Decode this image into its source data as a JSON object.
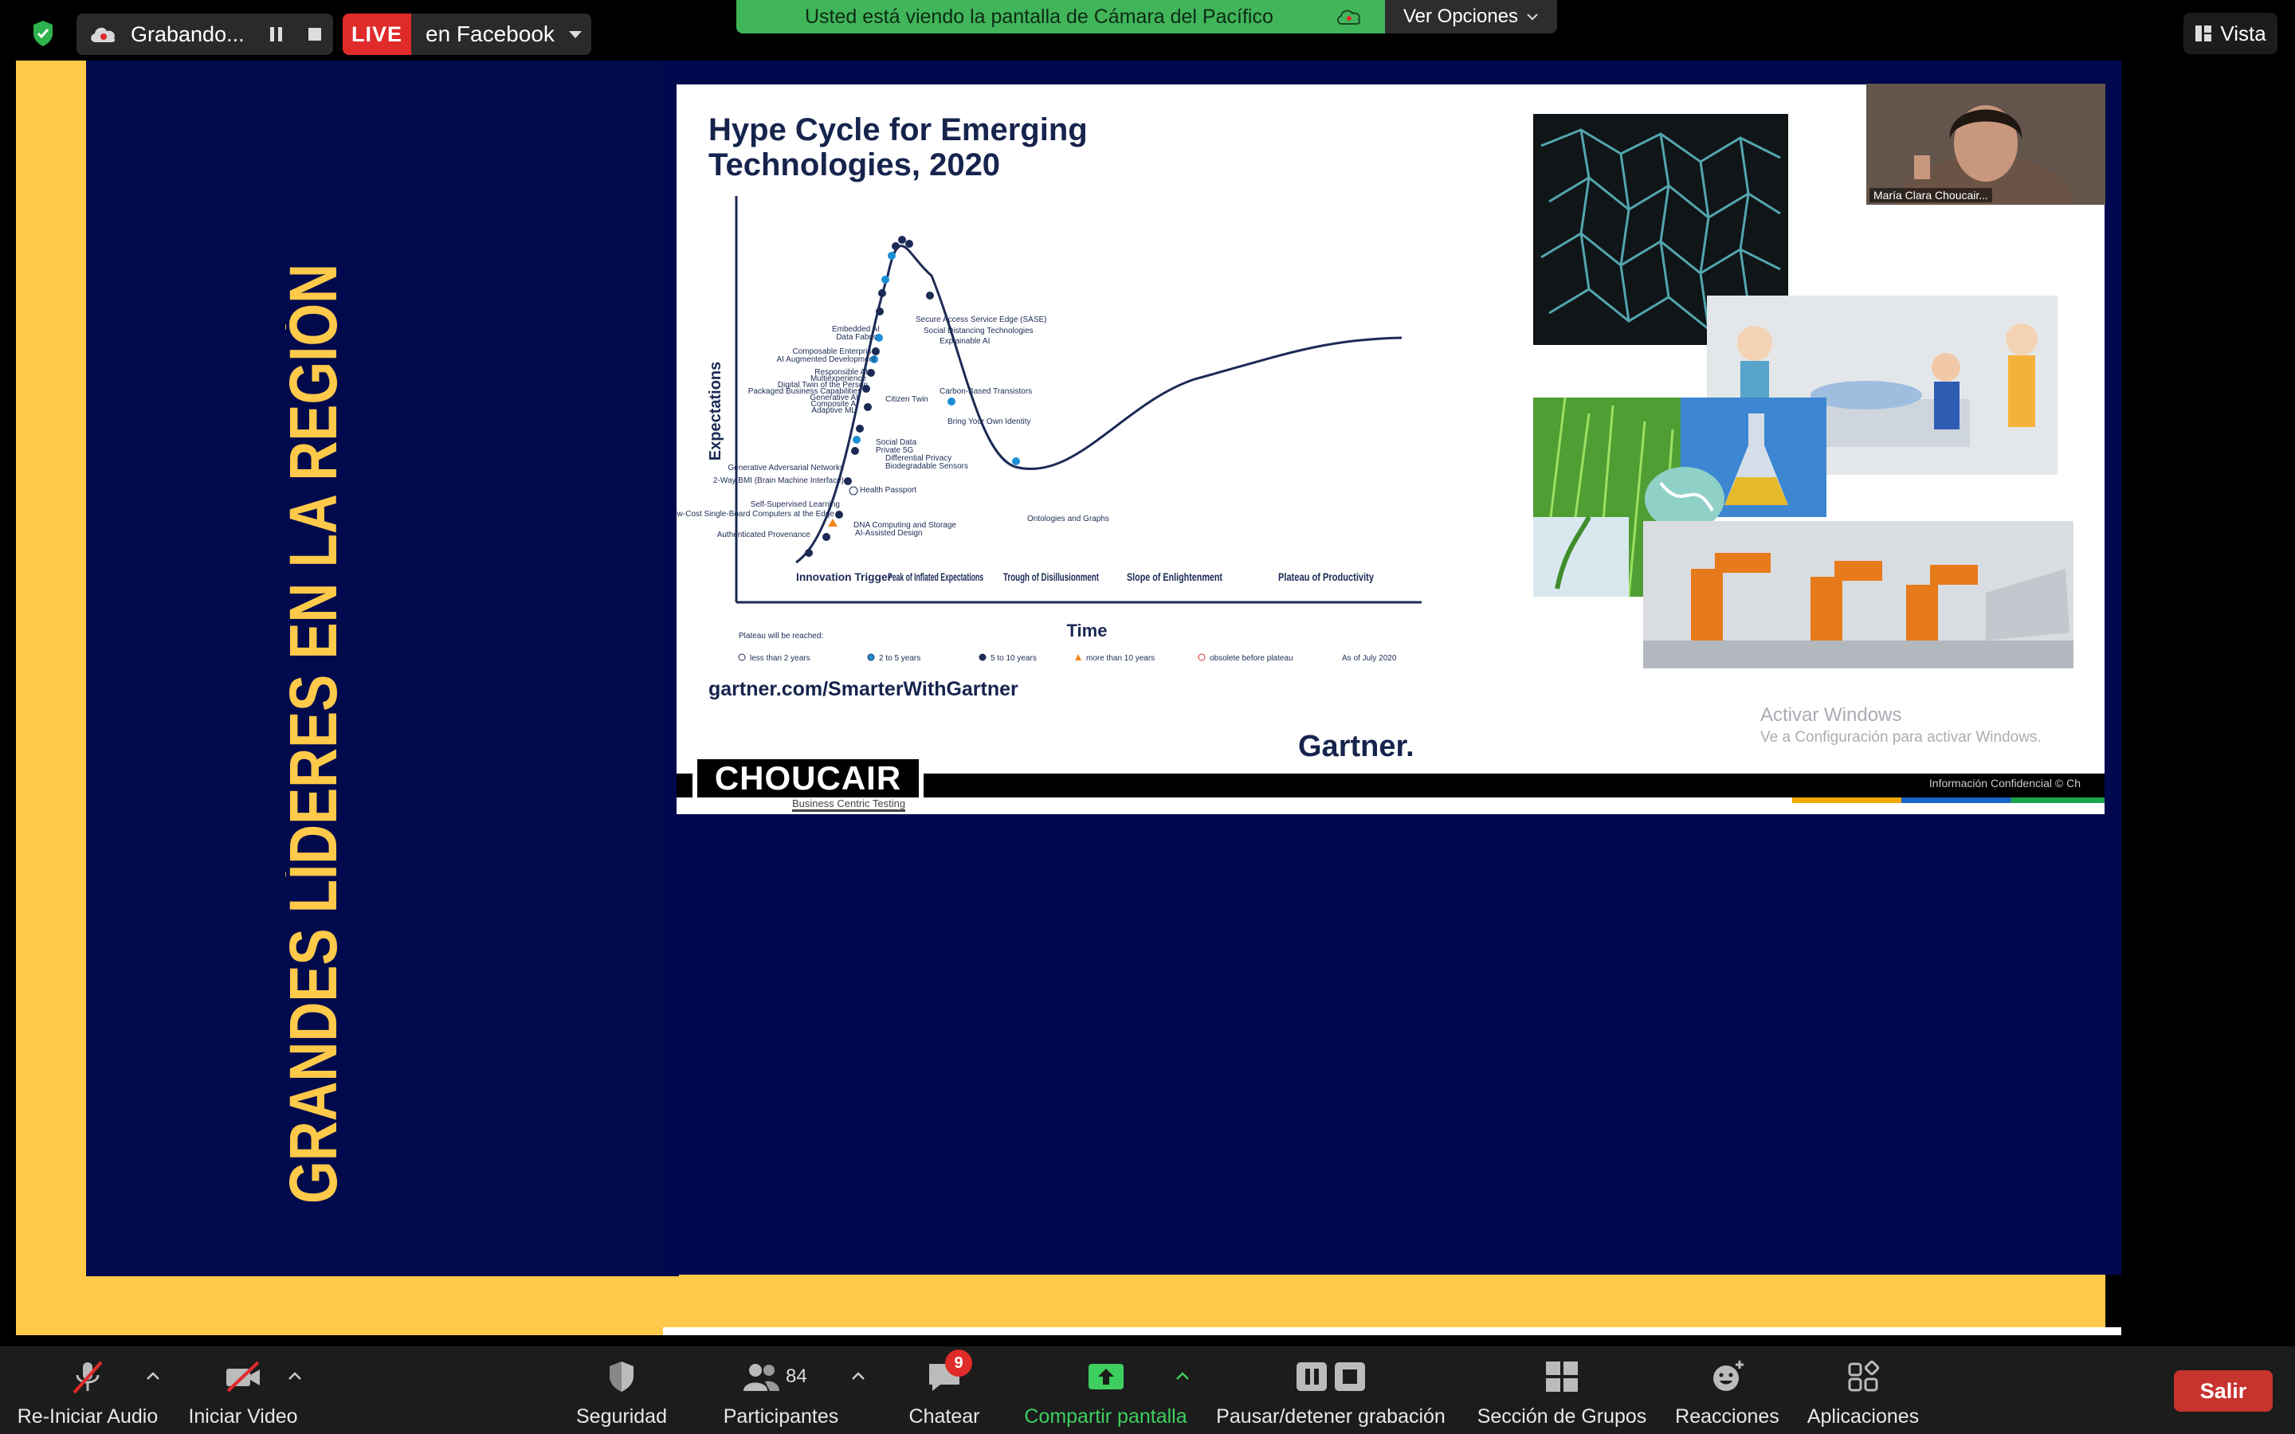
{
  "topbar": {
    "recording_label": "Grabando...",
    "live_label": "LIVE",
    "live_destination": "en Facebook",
    "viewing_text": "Usted está viendo la pantalla de Cámara del Pacífico",
    "options_label": "Ver Opciones",
    "view_label": "Vista"
  },
  "shared_screen": {
    "vertical_title": "GRANDES LÍDERES EN LA REGIÓN",
    "slide": {
      "hype_title_line1": "Hype Cycle for Emerging",
      "hype_title_line2": "Technologies, 2020",
      "y_axis": "Expectations",
      "x_axis": "Time",
      "phases": [
        "Innovation Trigger",
        "Peak of Inflated Expectations",
        "Trough of Disillusionment",
        "Slope of Enlightenment",
        "Plateau of Productivity"
      ],
      "technologies": [
        "Secure Access Service Edge (SASE)",
        "Social Distancing Technologies",
        "Embedded AI",
        "Data Fabric",
        "Explainable AI",
        "Composable Enterprise",
        "AI Augmented Development",
        "Carbon-Based Transistors",
        "Responsible AI",
        "Multiexperience",
        "Digital Twin of the Person",
        "Packaged Business Capabilities",
        "Citizen Twin",
        "Generative AI",
        "Composite AI",
        "Bring Your Own Identity",
        "Adaptive ML",
        "Social Data",
        "Private 5G",
        "Generative Adversarial Networks",
        "Differential Privacy",
        "Biodegradable Sensors",
        "Ontologies and Graphs",
        "2-Way BMI (Brain Machine Interface)",
        "Health Passport",
        "Self-Supervised Learning",
        "Low-Cost Single-Board Computers at the Edge",
        "DNA Computing and Storage",
        "AI-Assisted Design",
        "Authenticated Provenance"
      ],
      "legend_title": "Plateau will be reached:",
      "legend": [
        "less than 2 years",
        "2 to 5 years",
        "5 to 10 years",
        "more than 10 years",
        "obsolete before plateau"
      ],
      "as_of": "As of July 2020",
      "url": "gartner.com/SmarterWithGartner",
      "brand": "Gartner.",
      "activate_line1": "Activar Windows",
      "activate_line2": "Ve a Configuración para activar Windows.",
      "company_logo": "CHOUCAIR",
      "company_tagline": "Business Centric Testing",
      "confidential": "Información Confidencial © Ch"
    },
    "participant_name": "María Clara Choucair..."
  },
  "toolbar": {
    "audio_label": "Re-Iniciar Audio",
    "video_label": "Iniciar Video",
    "security_label": "Seguridad",
    "participants_label": "Participantes",
    "participants_count": "84",
    "chat_label": "Chatear",
    "chat_badge": "9",
    "share_label": "Compartir pantalla",
    "record_label": "Pausar/detener grabación",
    "breakout_label": "Sección de Grupos",
    "reactions_label": "Reacciones",
    "apps_label": "Aplicaciones",
    "leave_label": "Salir"
  },
  "colors": {
    "accent_green": "#41b55a",
    "live_red": "#e02b2b",
    "leave_red": "#c7332d",
    "slide_navy": "#00094d",
    "slide_yellow": "#ffc94a"
  }
}
